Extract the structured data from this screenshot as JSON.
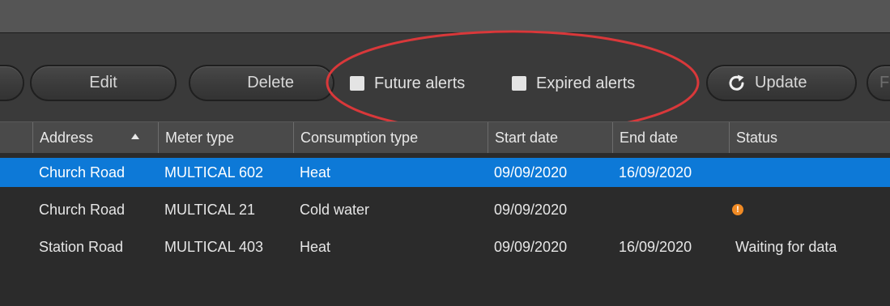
{
  "toolbar": {
    "edit_label": "Edit",
    "delete_label": "Delete",
    "update_label": "Update",
    "future_alerts_label": "Future alerts",
    "expired_alerts_label": "Expired alerts",
    "future_alerts_checked": false,
    "expired_alerts_checked": false,
    "next_button_partial_label": "F"
  },
  "table": {
    "columns": [
      "Address",
      "Meter type",
      "Consumption type",
      "Start date",
      "End date",
      "Status"
    ],
    "sort_column": "Address",
    "sort_direction": "ascending",
    "rows": [
      {
        "address": "Church Road",
        "meter_type": "MULTICAL 602",
        "consumption_type": "Heat",
        "start_date": "09/09/2020",
        "end_date": "16/09/2020",
        "status": "",
        "selected": true,
        "status_icon": null
      },
      {
        "address": "Church Road",
        "meter_type": "MULTICAL 21",
        "consumption_type": "Cold water",
        "start_date": "09/09/2020",
        "end_date": "",
        "status": "",
        "selected": false,
        "status_icon": "warning-icon"
      },
      {
        "address": "Station Road",
        "meter_type": "MULTICAL 403",
        "consumption_type": "Heat",
        "start_date": "09/09/2020",
        "end_date": "16/09/2020",
        "status": "Waiting for data",
        "selected": false,
        "status_icon": null
      }
    ]
  },
  "colors": {
    "selected_row": "#0d79d7",
    "annotation": "#d9383a",
    "warning": "#f08a24",
    "background": "#2b2b2b"
  }
}
